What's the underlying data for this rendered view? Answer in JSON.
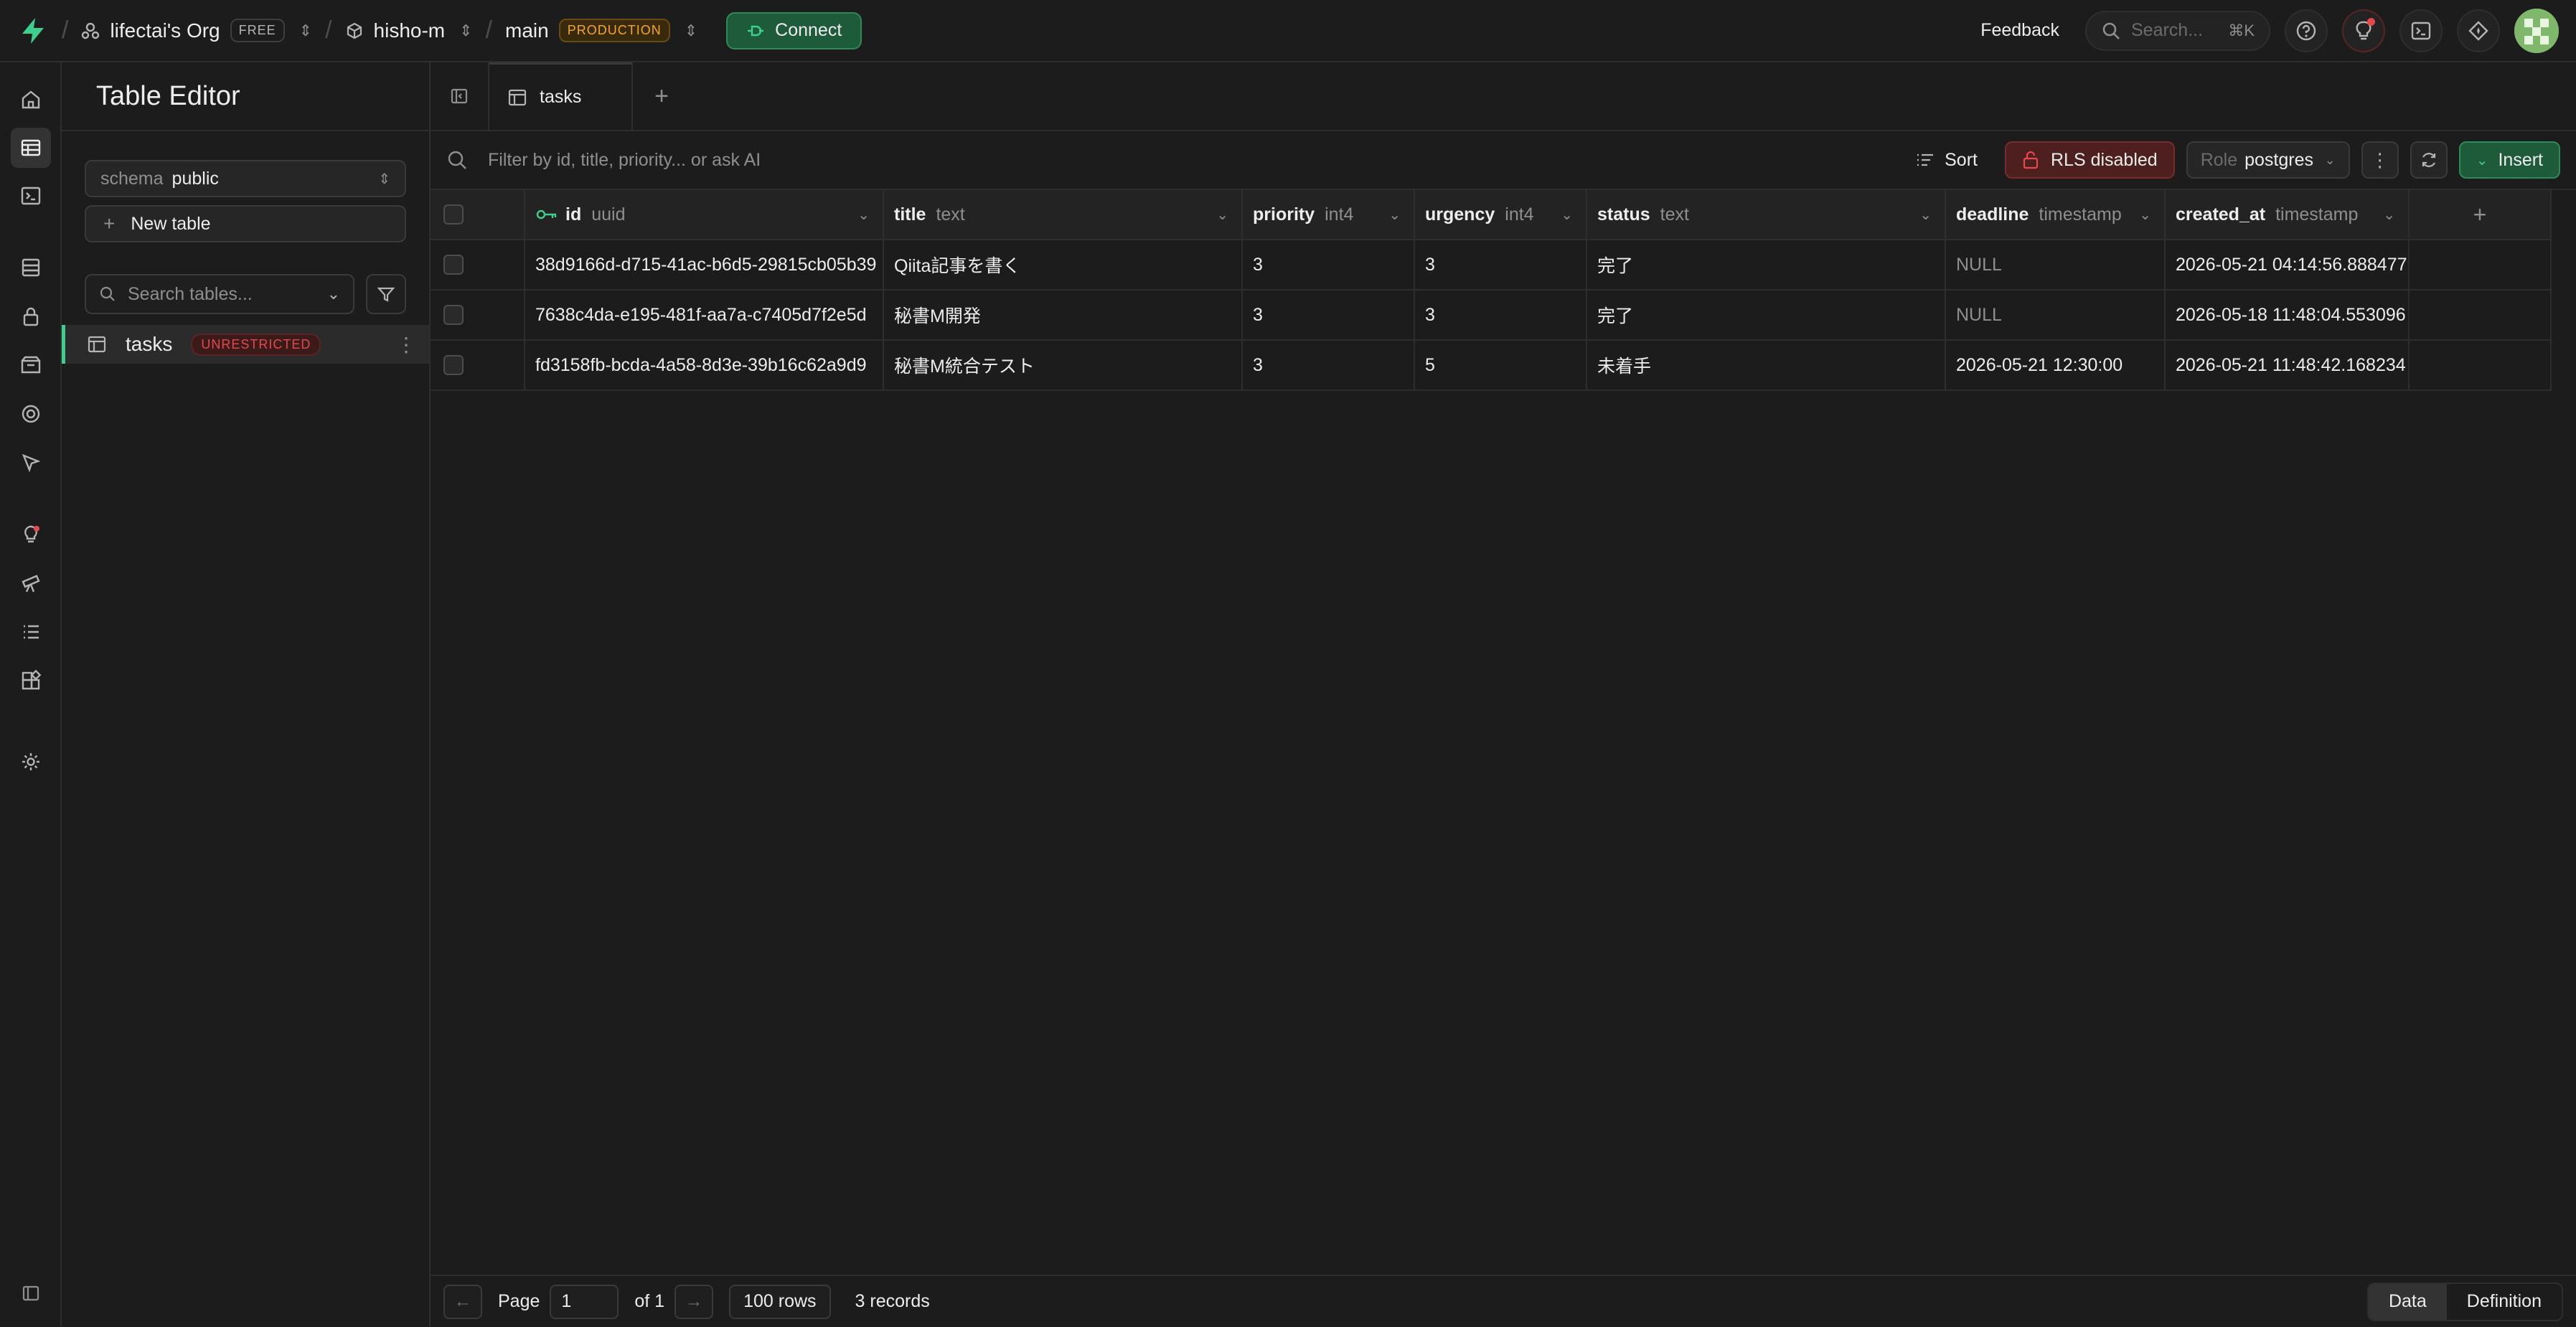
{
  "topbar": {
    "org_name": "lifectai's Org",
    "org_plan": "FREE",
    "project_name": "hisho-m",
    "branch_name": "main",
    "branch_badge": "PRODUCTION",
    "connect_label": "Connect",
    "feedback_label": "Feedback",
    "search_placeholder": "Search...",
    "search_shortcut": "⌘K"
  },
  "sidebar": {
    "title": "Table Editor",
    "schema_label": "schema",
    "schema_value": "public",
    "new_table_label": "New table",
    "search_placeholder": "Search tables...",
    "tables": [
      {
        "name": "tasks",
        "badge": "UNRESTRICTED"
      }
    ]
  },
  "tabs": [
    {
      "label": "tasks"
    }
  ],
  "toolbar": {
    "filter_placeholder": "Filter by id, title, priority... or ask AI",
    "sort_label": "Sort",
    "rls_label": "RLS disabled",
    "role_label": "Role",
    "role_value": "postgres",
    "insert_label": "Insert"
  },
  "grid": {
    "columns": [
      {
        "name": "id",
        "type": "uuid"
      },
      {
        "name": "title",
        "type": "text"
      },
      {
        "name": "priority",
        "type": "int4"
      },
      {
        "name": "urgency",
        "type": "int4"
      },
      {
        "name": "status",
        "type": "text"
      },
      {
        "name": "deadline",
        "type": "timestamp"
      },
      {
        "name": "created_at",
        "type": "timestamp"
      }
    ],
    "rows": [
      [
        "38d9166d-d715-41ac-b6d5-29815cb05b39",
        "Qiita記事を書く",
        "3",
        "3",
        "完了",
        "NULL",
        "2026-05-21 04:14:56.888477"
      ],
      [
        "7638c4da-e195-481f-aa7a-c7405d7f2e5d",
        "秘書M開発",
        "3",
        "3",
        "完了",
        "NULL",
        "2026-05-18 11:48:04.553096"
      ],
      [
        "fd3158fb-bcda-4a58-8d3e-39b16c62a9d9",
        "秘書M統合テスト",
        "3",
        "5",
        "未着手",
        "2026-05-21 12:30:00",
        "2026-05-21 11:48:42.168234"
      ]
    ]
  },
  "footer": {
    "page_label": "Page",
    "page_value": "1",
    "of_label": "of 1",
    "rows_label": "100 rows",
    "records_label": "3 records",
    "view_data": "Data",
    "view_definition": "Definition"
  },
  "colors": {
    "accent": "#3ecf8e",
    "danger": "#e5484d",
    "warning": "#f5a623",
    "background": "#1c1c1c"
  }
}
